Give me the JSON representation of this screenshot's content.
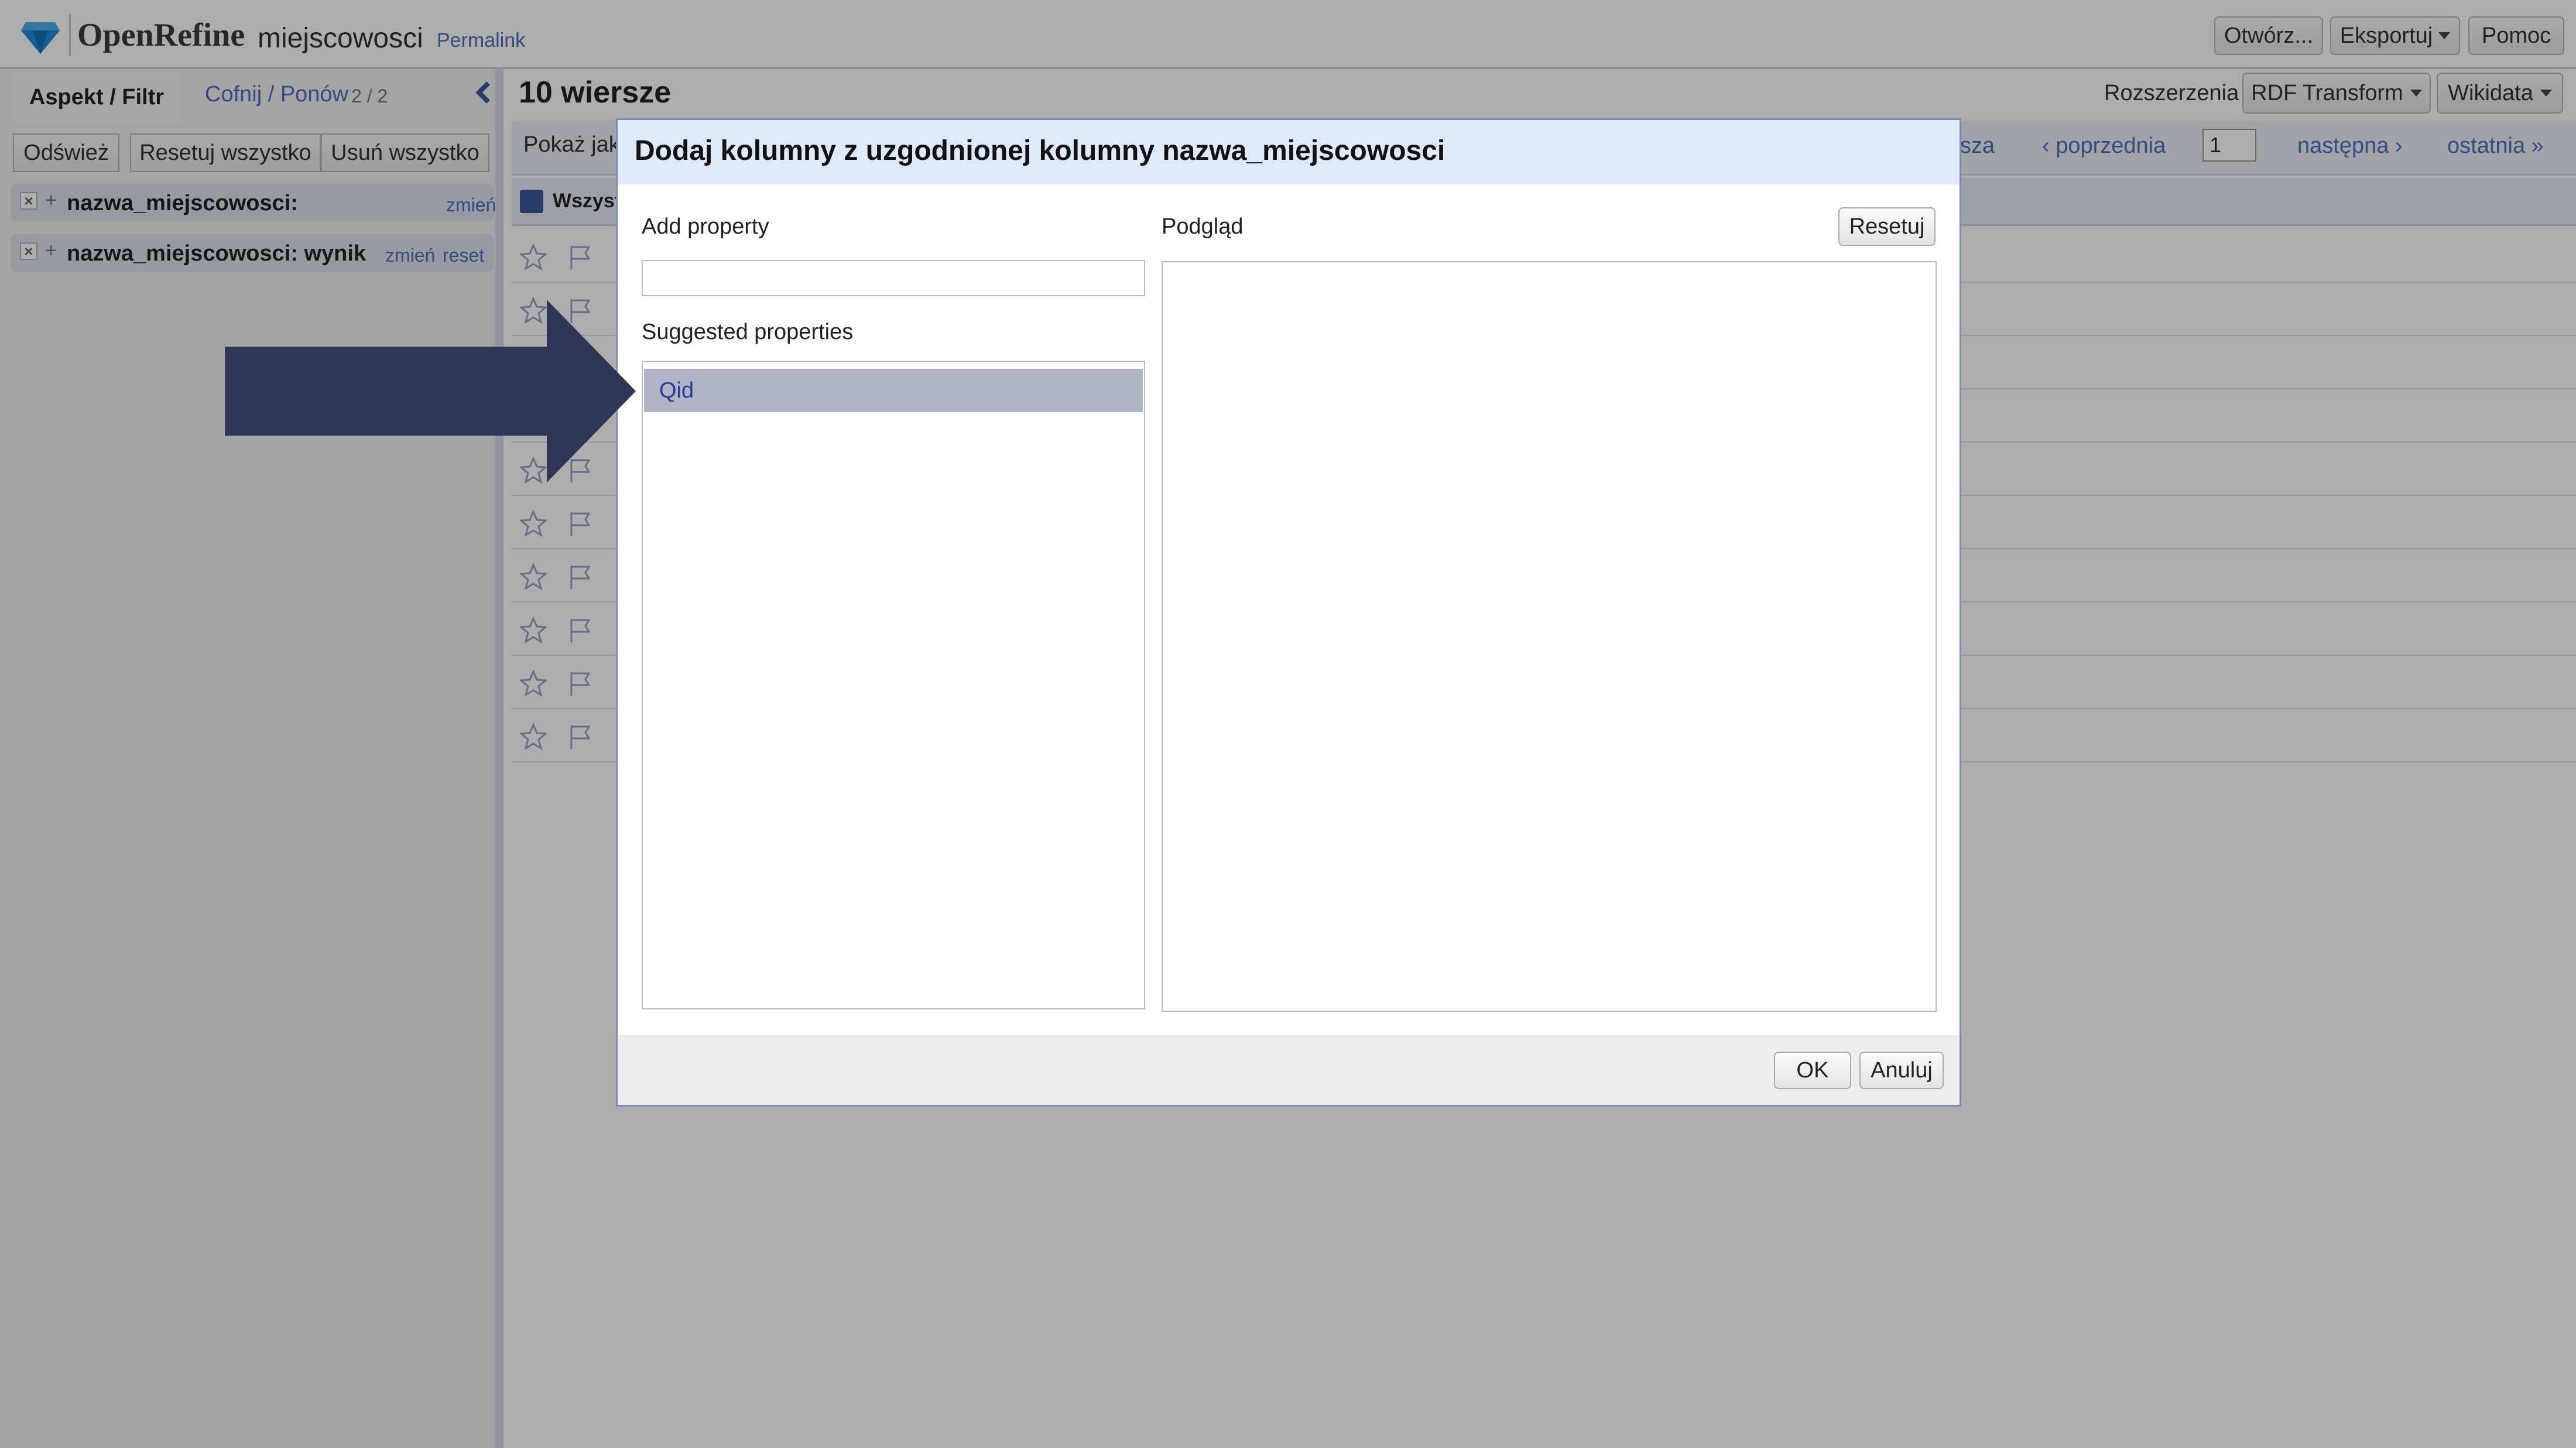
{
  "header": {
    "app_name": "OpenRefine",
    "project_name": "miejscowosci",
    "permalink": "Permalink",
    "buttons": {
      "open": "Otwórz...",
      "export": "Eksportuj",
      "help": "Pomoc"
    }
  },
  "left_panel": {
    "tabs": {
      "facet": "Aspekt / Filtr",
      "undo": "Cofnij / Ponów",
      "undo_count": "2 / 2"
    },
    "actions": {
      "refresh": "Odśwież",
      "reset_all": "Resetuj wszystko",
      "remove_all": "Usuń wszystko"
    },
    "facets": [
      {
        "name": "nazwa_miejscowosci:",
        "change": "zmień",
        "reset": ""
      },
      {
        "name": "nazwa_miejscowosci: wynik",
        "change": "zmień",
        "reset": "reset"
      }
    ]
  },
  "main": {
    "row_count": "10 wiersze",
    "extensions_label": "Rozszerzenia",
    "buttons": {
      "rdf": "RDF Transform",
      "wikidata": "Wikidata"
    },
    "show_as": "Pokaż jak",
    "pager": {
      "first_partial": "sza",
      "prev": "‹ poprzednia",
      "page": "1",
      "next": "następna ›",
      "last": "ostatnia »"
    },
    "all_columns": "Wszyst",
    "rows": 10
  },
  "dialog": {
    "title": "Dodaj kolumny z uzgodnionej kolumny nazwa_miejscowosci",
    "add_property_label": "Add property",
    "add_property_value": "",
    "suggested_label": "Suggested properties",
    "suggested_items": [
      "Qid"
    ],
    "preview_label": "Podgląd",
    "reset_button": "Resetuj",
    "ok_button": "OK",
    "cancel_button": "Anuluj"
  },
  "colors": {
    "accent_link": "#4d71be",
    "dialog_header": "#dee9fa",
    "selected_item_bg": "#aeb3c6",
    "selected_item_text": "#2b3b93",
    "arrow": "#303756"
  }
}
